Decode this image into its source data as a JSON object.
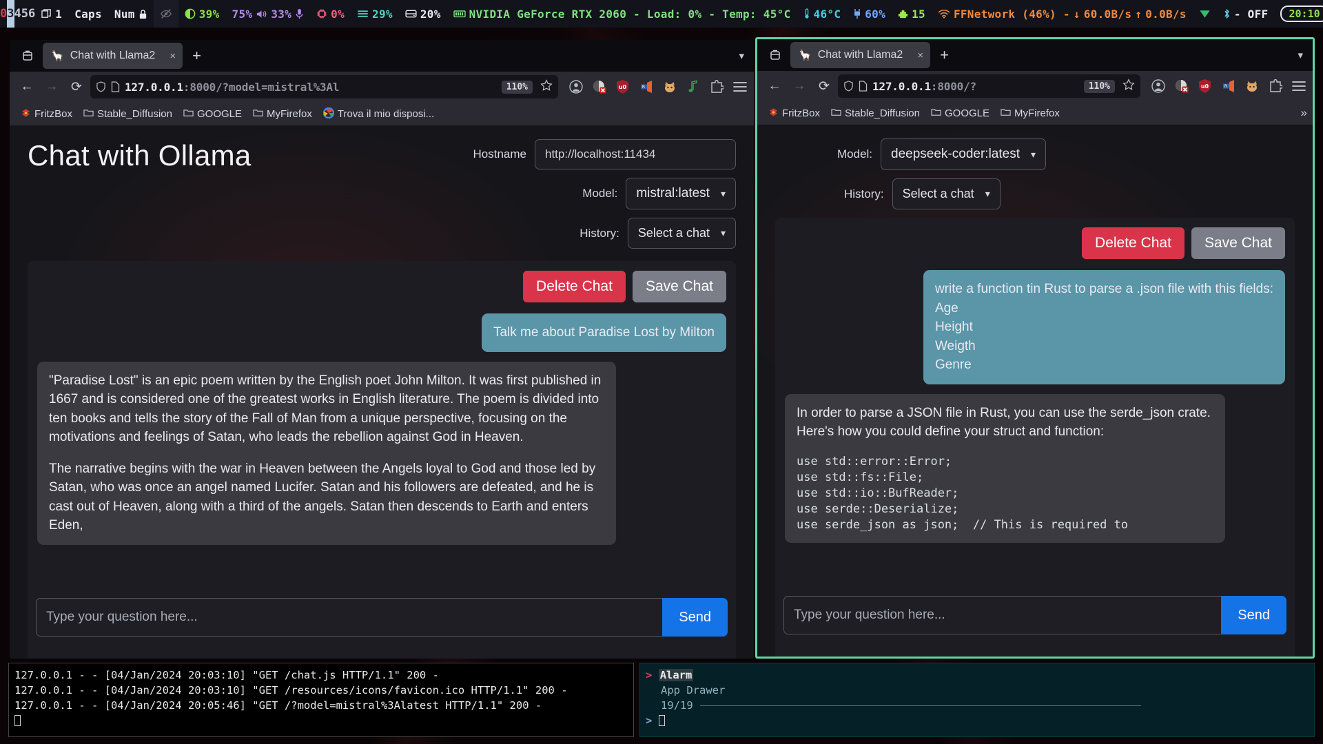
{
  "statusbar": {
    "workspaces": [
      {
        "label": "0",
        "state": "urgent"
      },
      {
        "label": "3",
        "state": "active"
      },
      {
        "label": "4",
        "state": "normal"
      },
      {
        "label": "5",
        "state": "normal"
      },
      {
        "label": "6",
        "state": "normal"
      }
    ],
    "window_count": "1",
    "caps": "Caps",
    "num": "Num",
    "brightness": "39%",
    "volume_left": "75%",
    "mic": "33%",
    "cpu": "0%",
    "memory": "29%",
    "disk": "20%",
    "gpu": "NVIDIA GeForce RTX 2060 - Load: 0% - Temp: 45°C",
    "temperature": "46°C",
    "battery": "60%",
    "packages": "15",
    "network": "FFNetwork (46%) -",
    "net_down": "60.0B/s",
    "net_up": "0.0B/s",
    "bluetooth": "- OFF",
    "clock": "20:10",
    "icons": {
      "windows": "⧉",
      "lock": "🔒",
      "eye_off": "eye-off-icon",
      "brightness": "◑",
      "speaker": "🔊",
      "mic": "🎙",
      "cpu": "cpu-icon",
      "memory": "☰",
      "disk": "⬜",
      "gpu": "gpu-icon",
      "thermometer": "🌡",
      "battery": "🔌",
      "package": "🧩",
      "wifi": "📶",
      "down": "↓",
      "up": "↑",
      "vpn": "▼",
      "bluetooth": "Ƀ",
      "power": "⏻"
    }
  },
  "windows": {
    "left": {
      "tab": {
        "favicon": "🦙",
        "title": "Chat with Llama2",
        "close": "×"
      },
      "newtab_label": "+",
      "nav": {
        "back": "←",
        "forward": "→",
        "reload": "⟳"
      },
      "url_main": "127.0.0.1",
      "url_rest": ":8000/?model=mistral%3Al",
      "zoom": "110%",
      "bookmarks": [
        {
          "label": "FritzBox",
          "icon": "fritzbox-icon"
        },
        {
          "label": "Stable_Diffusion",
          "icon": "folder-icon"
        },
        {
          "label": "GOOGLE",
          "icon": "folder-icon"
        },
        {
          "label": "MyFirefox",
          "icon": "folder-icon"
        },
        {
          "label": "Trova il mio disposi...",
          "icon": "google-icon"
        }
      ],
      "page": {
        "title": "Chat with Ollama",
        "hostname_label": "Hostname",
        "hostname_value": "http://localhost:11434",
        "model_label": "Model:",
        "model_value": "mistral:latest",
        "history_label": "History:",
        "history_value": "Select a chat",
        "delete_label": "Delete Chat",
        "save_label": "Save Chat",
        "user_message": "Talk me about Paradise Lost by Milton",
        "bot_paragraph_1": "\"Paradise Lost\" is an epic poem written by the English poet John Milton. It was first published in 1667 and is considered one of the greatest works in English literature. The poem is divided into ten books and tells the story of the Fall of Man from a unique perspective, focusing on the motivations and feelings of Satan, who leads the rebellion against God in Heaven.",
        "bot_paragraph_2": "The narrative begins with the war in Heaven between the Angels loyal to God and those led by Satan, who was once an angel named Lucifer. Satan and his followers are defeated, and he is cast out of Heaven, along with a third of the angels. Satan then descends to Earth and enters Eden,",
        "input_placeholder": "Type your question here...",
        "send_label": "Send"
      }
    },
    "right": {
      "tab": {
        "favicon": "🦙",
        "title": "Chat with Llama2",
        "close": "×"
      },
      "newtab_label": "+",
      "nav": {
        "back": "←",
        "forward": "→",
        "reload": "⟳"
      },
      "url_main": "127.0.0.1",
      "url_rest": ":8000/?",
      "zoom": "110%",
      "bookmarks": [
        {
          "label": "FritzBox",
          "icon": "fritzbox-icon"
        },
        {
          "label": "Stable_Diffusion",
          "icon": "folder-icon"
        },
        {
          "label": "GOOGLE",
          "icon": "folder-icon"
        },
        {
          "label": "MyFirefox",
          "icon": "folder-icon"
        }
      ],
      "overflow": "»",
      "page": {
        "model_label": "Model:",
        "model_value": "deepseek-coder:latest",
        "history_label": "History:",
        "history_value": "Select a chat",
        "delete_label": "Delete Chat",
        "save_label": "Save Chat",
        "user_message_lines": [
          "write a function tin Rust to parse a .json file with this fields:",
          "Age",
          "Height",
          "Weigth",
          "Genre"
        ],
        "bot_intro": "In order to parse a JSON file in Rust, you can use the serde_json crate. Here's how you could define your struct and function:",
        "bot_code": "use std::error::Error;\nuse std::fs::File;\nuse std::io::BufReader;\nuse serde::Deserialize;\nuse serde_json as json;  // This is required to",
        "input_placeholder": "Type your question here...",
        "send_label": "Send"
      }
    }
  },
  "terminals": {
    "left": {
      "lines": [
        "127.0.0.1 - - [04/Jan/2024 20:03:10] \"GET /chat.js HTTP/1.1\" 200 -",
        "127.0.0.1 - - [04/Jan/2024 20:03:10] \"GET /resources/icons/favicon.ico HTTP/1.1\" 200 -",
        "127.0.0.1 - - [04/Jan/2024 20:05:46] \"GET /?model=mistral%3Alatest HTTP/1.1\" 200 -"
      ]
    },
    "right": {
      "prompt": ">",
      "selected": "Alarm",
      "entry": "App Drawer",
      "count": "19/19",
      "input_prompt": ">"
    }
  },
  "colors": {
    "accent_blue": "#1473e6",
    "danger_red": "#d9344a",
    "save_gray": "#7b7d88",
    "user_bubble": "#5b95a8",
    "bot_bubble": "#3b3a41",
    "window_focus_border": "#5fd6a8"
  }
}
